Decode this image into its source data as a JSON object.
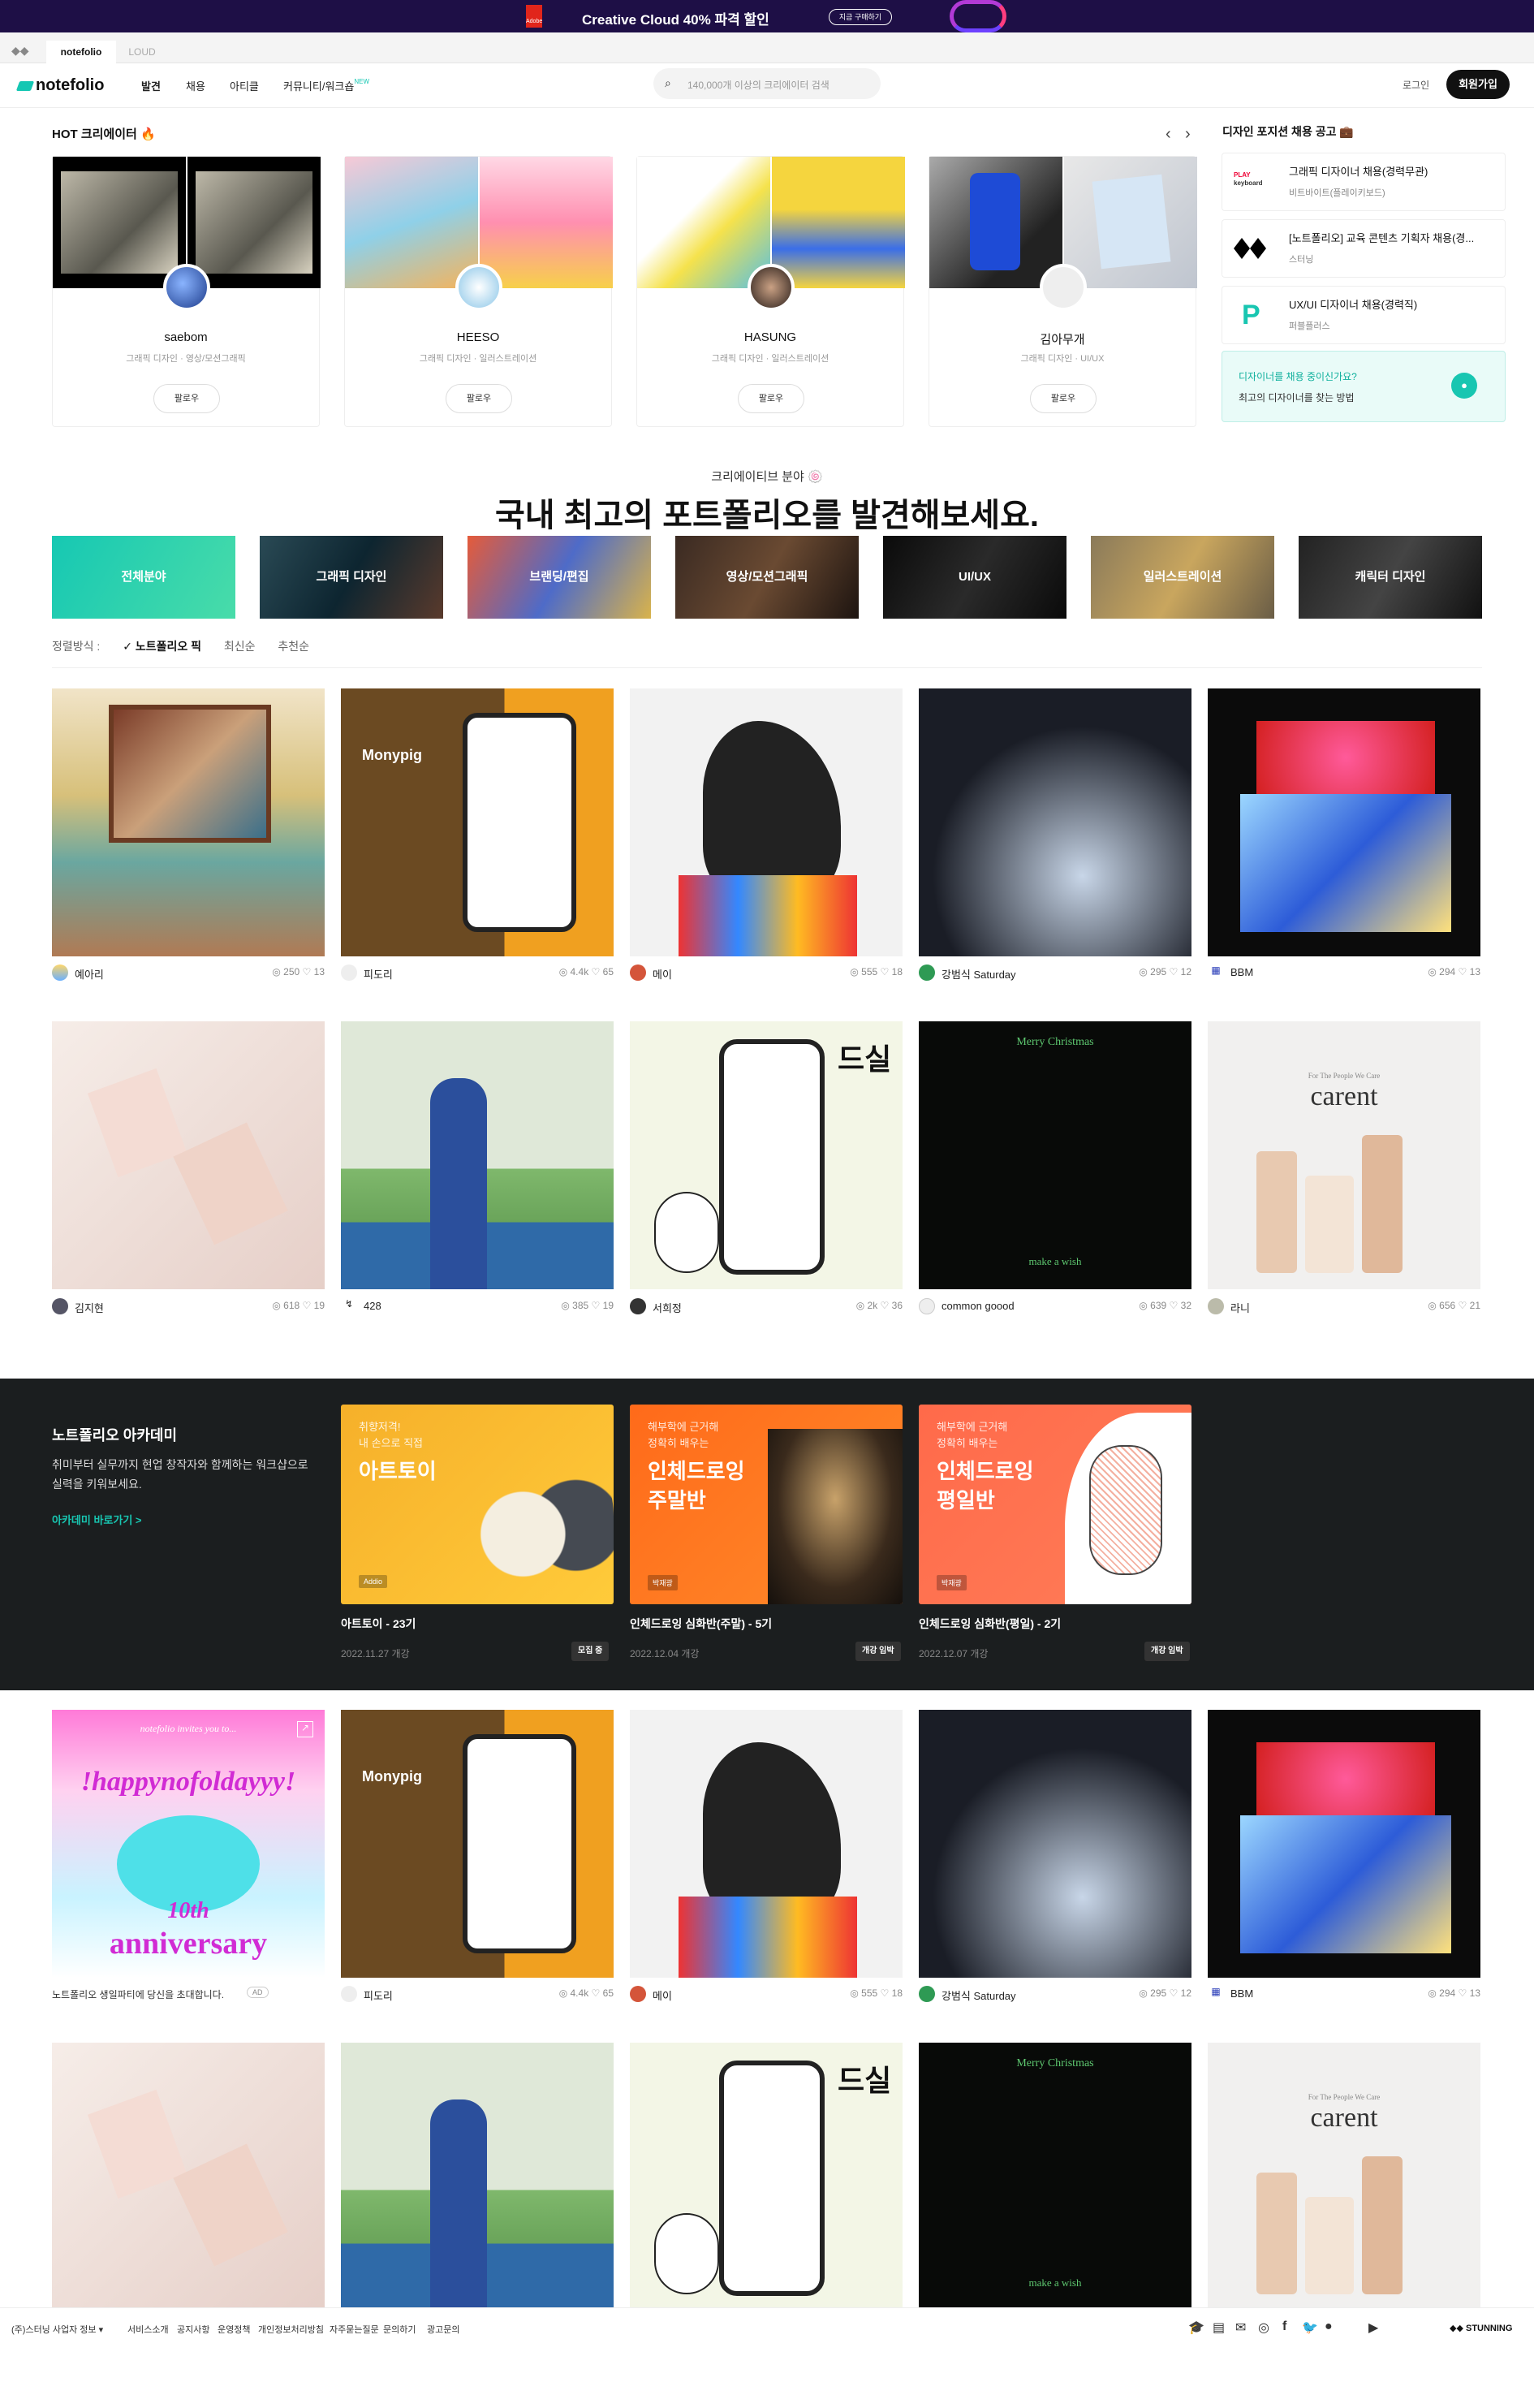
{
  "promo": {
    "adobe_label": "Adobe",
    "text": "Creative Cloud 40% 파격 할인",
    "button": "지금 구매하기"
  },
  "subbar": {
    "tab_active": "notefolio",
    "tab_other": "LOUD"
  },
  "nav": {
    "logo": "notefolio",
    "links": [
      "발견",
      "채용",
      "아티클",
      "커뮤니티/워크숍"
    ],
    "new_badge": "NEW",
    "search_placeholder": "140,000개 이상의 크리에이터 검색",
    "login": "로그인",
    "signup": "회원가입"
  },
  "hot": {
    "title": "HOT 크리에이터 🔥",
    "creators": [
      {
        "name": "saebom",
        "category": "그래픽 디자인 · 영상/모션그래픽",
        "follow": "팔로우"
      },
      {
        "name": "HEESO",
        "category": "그래픽 디자인 · 일러스트레이션",
        "follow": "팔로우"
      },
      {
        "name": "HASUNG",
        "category": "그래픽 디자인 · 일러스트레이션",
        "follow": "팔로우"
      },
      {
        "name": "김아무개",
        "category": "그래픽 디자인 · UI/UX",
        "follow": "팔로우"
      }
    ]
  },
  "jobs": {
    "title": "디자인 포지션 채용 공고 💼",
    "items": [
      {
        "title": "그래픽 디자이너 채용(경력무관)",
        "company": "비트바이트(플레이키보드)"
      },
      {
        "title": "[노트폴리오] 교육 콘텐츠 기획자 채용(경...",
        "company": "스터닝"
      },
      {
        "title": "UX/UI 디자이너 채용(경력직)",
        "company": "퍼블플러스"
      }
    ],
    "cta_title": "디자이너를 채용 중이신가요?",
    "cta_sub": "최고의 디자이너를 찾는 방법"
  },
  "fields": {
    "small": "크리에이티브 분야 🍥",
    "big": "국내 최고의 포트폴리오를 발견해보세요.",
    "categories": [
      "전체분야",
      "그래픽 디자인",
      "브랜딩/편집",
      "영상/모션그래픽",
      "UI/UX",
      "일러스트레이션",
      "캐릭터 디자인"
    ]
  },
  "sort": {
    "label": "정렬방식 :",
    "options": [
      "✓ 노트폴리오 픽",
      "최신순",
      "추천순"
    ]
  },
  "works_row1": [
    {
      "author": "예아리",
      "views": "◎ 250",
      "likes": "♡ 13"
    },
    {
      "author": "피도리",
      "views": "◎ 4.4k",
      "likes": "♡ 65"
    },
    {
      "author": "메이",
      "views": "◎ 555",
      "likes": "♡ 18"
    },
    {
      "author": "강범식 Saturday",
      "views": "◎ 295",
      "likes": "♡ 12"
    },
    {
      "author": "BBM",
      "views": "◎ 294",
      "likes": "♡ 13"
    }
  ],
  "works_row2": [
    {
      "author": "김지현",
      "views": "◎ 618",
      "likes": "♡ 19"
    },
    {
      "author": "428",
      "views": "◎ 385",
      "likes": "♡ 19"
    },
    {
      "author": "서희정",
      "views": "◎ 2k",
      "likes": "♡ 36"
    },
    {
      "author": "common goood",
      "views": "◎ 639",
      "likes": "♡ 32"
    },
    {
      "author": "라니",
      "views": "◎ 656",
      "likes": "♡ 21"
    }
  ],
  "thumb_text": {
    "monypig": "Monypig",
    "dsil": "드실",
    "merry": "Merry Christmas",
    "wish": "make a wish",
    "carent": "carent",
    "carent_sub": "For The People We Care"
  },
  "academy": {
    "title": "노트폴리오 아카데미",
    "desc": "취미부터 실무까지 현업 창작자와 함께하는 워크샵으로 실력을 키워보세요.",
    "link": "아카데미 바로가기 >",
    "courses": [
      {
        "kicker": "취향저격!\n내 손으로 직접",
        "headline": "아트토이",
        "tag": "Addio",
        "title": "아트토이 - 23기",
        "date": "2022.11.27 개강",
        "badge": "모집 중"
      },
      {
        "kicker": "해부학에 근거해\n정확히 배우는",
        "headline": "인체드로잉\n주말반",
        "tag": "박재광",
        "title": "인체드로잉 심화반(주말) - 5기",
        "date": "2022.12.04 개강",
        "badge": "개강 임박"
      },
      {
        "kicker": "해부학에 근거해\n정확히 배우는",
        "headline": "인체드로잉\n평일반",
        "tag": "박재광",
        "title": "인체드로잉 심화반(평일) - 2기",
        "date": "2022.12.07 개강",
        "badge": "개강 임박"
      }
    ]
  },
  "ad": {
    "top": "notefolio invites you to...",
    "line1": "!happynofoldayyy!",
    "line2": "10th",
    "line3": "anniversary",
    "caption": "노트폴리오 생일파티에 당신을 초대합니다.",
    "ad_tag": "AD"
  },
  "works_row3": [
    {
      "author": "피도리",
      "views": "◎ 4.4k",
      "likes": "♡ 65"
    },
    {
      "author": "메이",
      "views": "◎ 555",
      "likes": "♡ 18"
    },
    {
      "author": "강범식 Saturday",
      "views": "◎ 295",
      "likes": "♡ 12"
    },
    {
      "author": "BBM",
      "views": "◎ 294",
      "likes": "♡ 13"
    }
  ],
  "footer": {
    "links": [
      "(주)스터닝 사업자 정보 ▾",
      "서비스소개",
      "공지사항",
      "운영정책",
      "개인정보처리방침",
      "자주묻는질문",
      "문의하기",
      "광고문의"
    ],
    "brand": "STUNNING"
  },
  "colors": {
    "accent": "#15c7b3",
    "dark": "#1b1e1f",
    "promo": "#1e0f46"
  }
}
